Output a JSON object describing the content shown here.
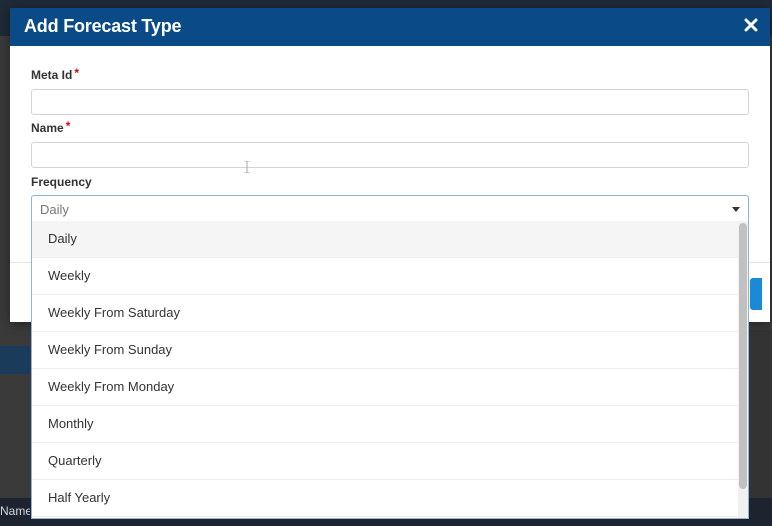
{
  "modal": {
    "title": "Add Forecast Type",
    "close_icon": "close-icon"
  },
  "form": {
    "meta_id": {
      "label": "Meta Id",
      "required_mark": "*",
      "value": "",
      "placeholder": ""
    },
    "name": {
      "label": "Name",
      "required_mark": "*",
      "value": "",
      "placeholder": ""
    },
    "frequency": {
      "label": "Frequency",
      "selected": "Daily",
      "options": [
        "Daily",
        "Weekly",
        "Weekly From Saturday",
        "Weekly From Sunday",
        "Weekly From Monday",
        "Monthly",
        "Quarterly",
        "Half Yearly"
      ]
    }
  },
  "background": {
    "column_header": "Name"
  },
  "colors": {
    "header_bg": "#0a4a87",
    "required": "#d0021b",
    "select_border": "#8fb4d9",
    "primary_button": "#1b8ad6"
  }
}
